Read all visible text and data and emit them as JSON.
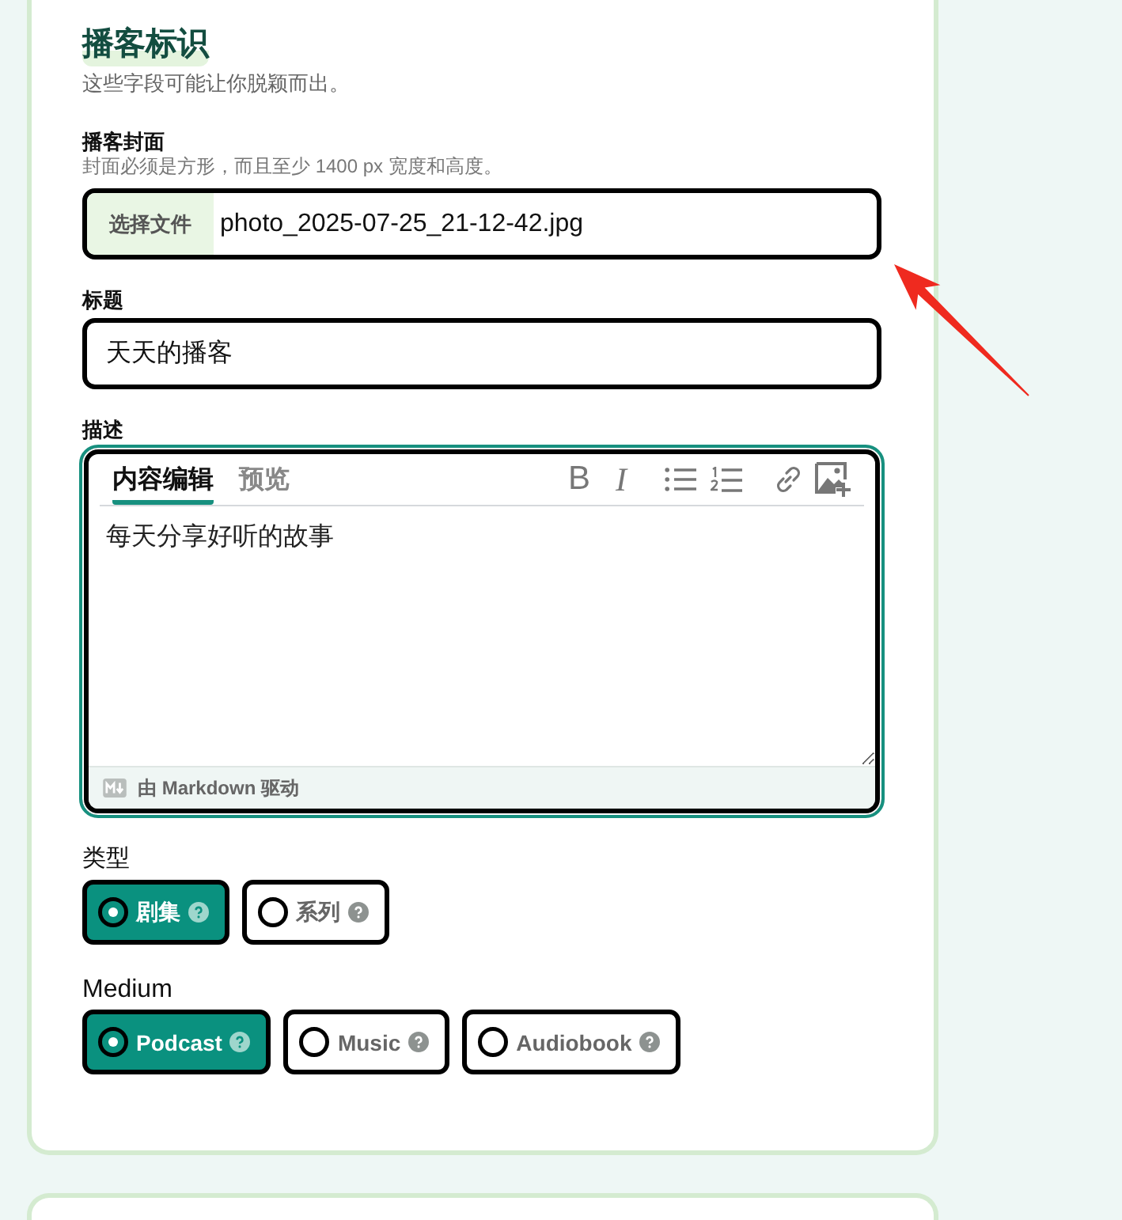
{
  "section": {
    "title": "播客标识",
    "subtitle": "这些字段可能让你脱颖而出。"
  },
  "cover": {
    "label": "播客封面",
    "hint": "封面必须是方形，而且至少 1400 px 宽度和高度。",
    "button": "选择文件",
    "file_name": "photo_2025-07-25_21-12-42.jpg"
  },
  "title_field": {
    "label": "标题",
    "value": "天天的播客"
  },
  "description": {
    "label": "描述",
    "tabs": [
      {
        "label": "内容编辑",
        "selected": true
      },
      {
        "label": "预览",
        "selected": false
      }
    ],
    "toolbar": [
      {
        "kind": "bold",
        "label": "B"
      },
      {
        "kind": "italic",
        "label": "I"
      },
      {
        "kind": "bullet-list"
      },
      {
        "kind": "numbered-list"
      },
      {
        "kind": "link"
      },
      {
        "kind": "image"
      }
    ],
    "value": "每天分享好听的故事",
    "footer": "由 Markdown 驱动"
  },
  "type_field": {
    "label": "类型",
    "options": [
      {
        "label": "剧集",
        "selected": true
      },
      {
        "label": "系列",
        "selected": false
      }
    ]
  },
  "medium_field": {
    "label": "Medium",
    "options": [
      {
        "label": "Podcast",
        "selected": true
      },
      {
        "label": "Music",
        "selected": false
      },
      {
        "label": "Audiobook",
        "selected": false
      }
    ]
  }
}
